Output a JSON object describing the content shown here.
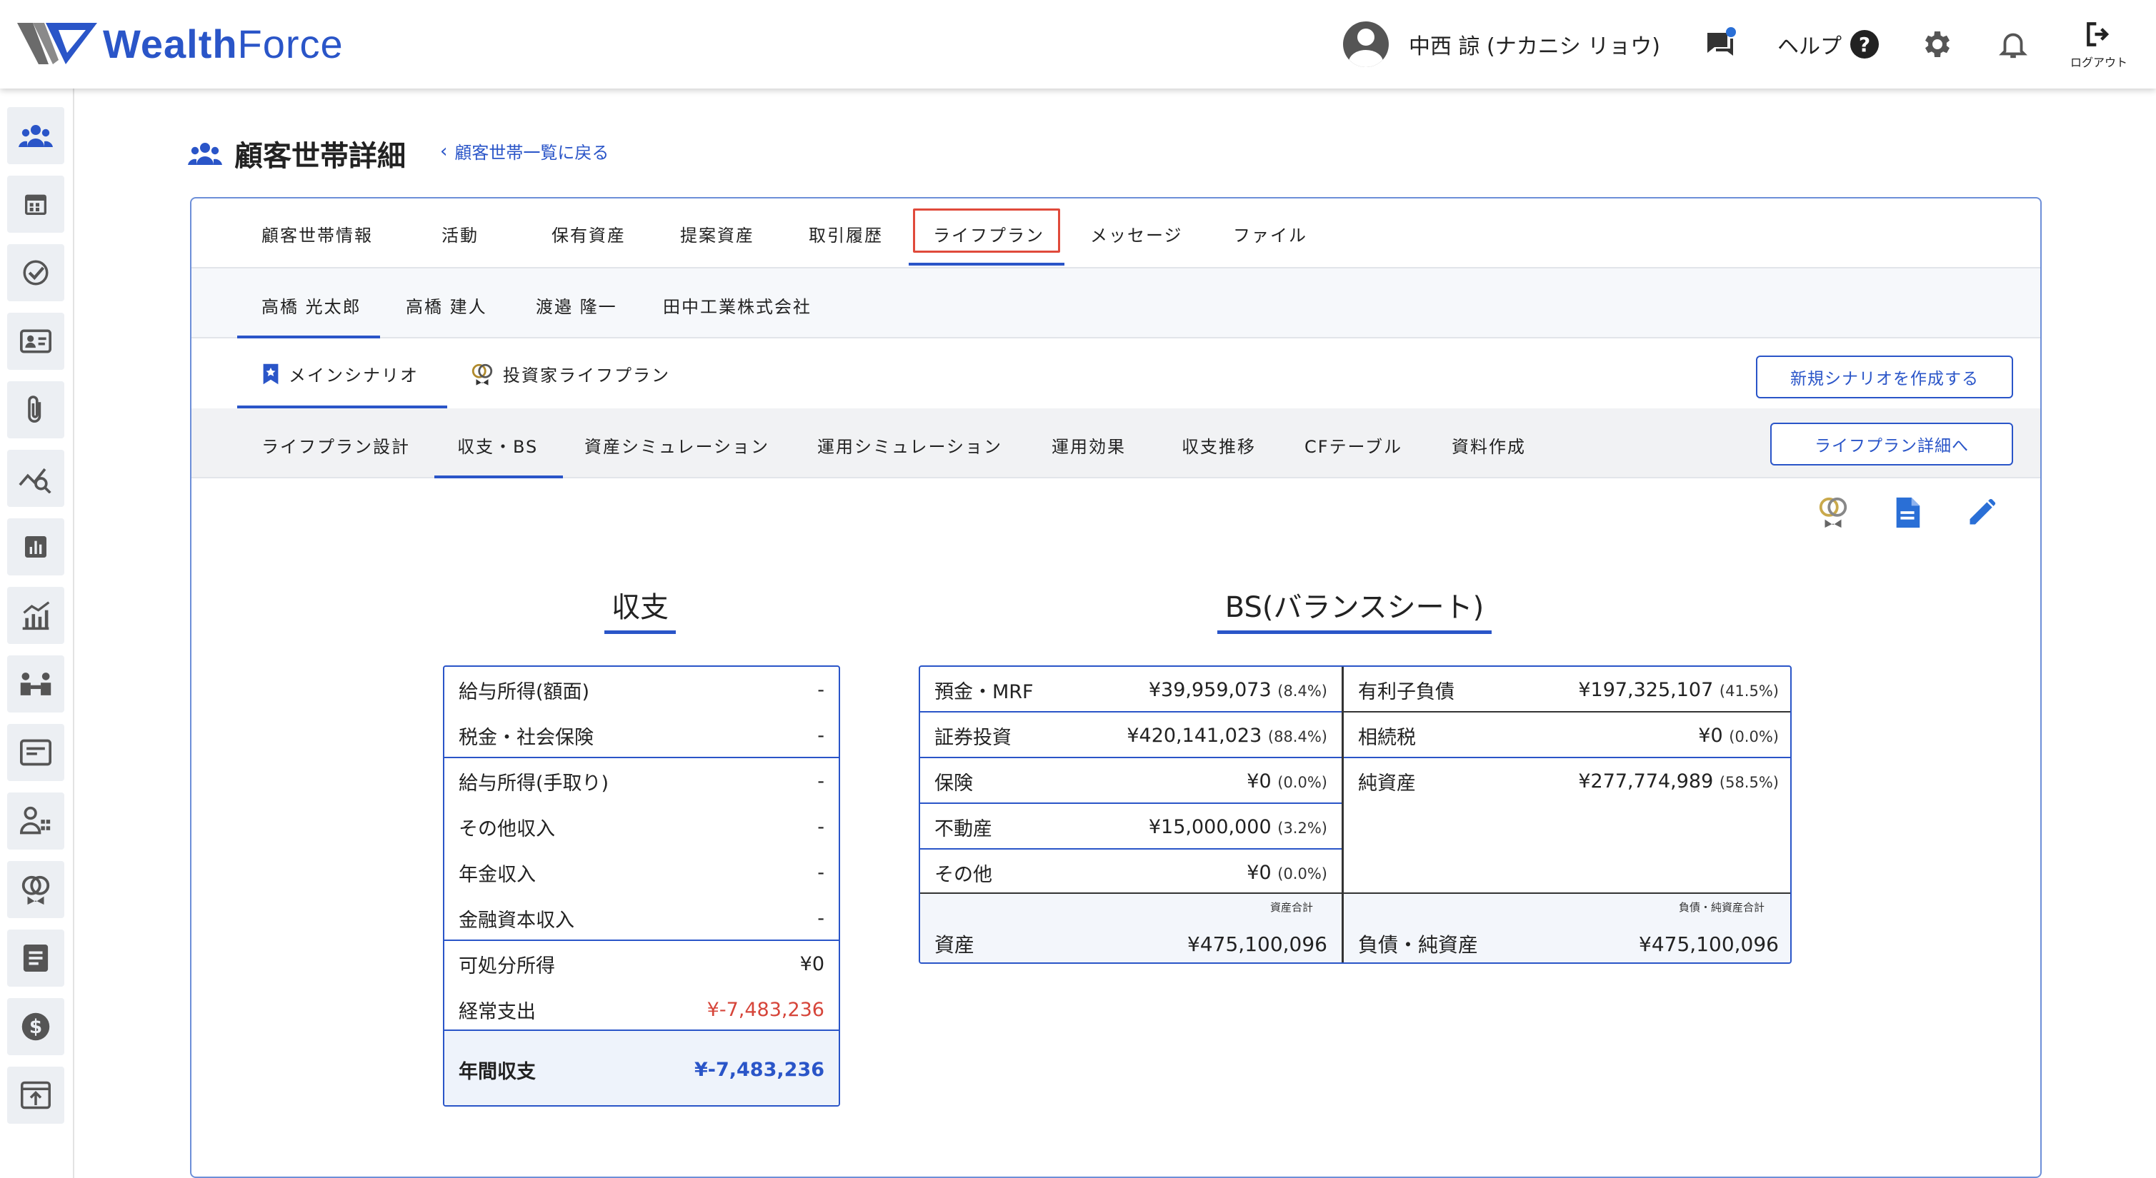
{
  "header": {
    "brand_a": "Wealth",
    "brand_b": "Force",
    "user_name": "中西 諒 (ナカニシ リョウ)",
    "help_label": "ヘルプ",
    "logout_label": "ログアウト"
  },
  "page": {
    "title": "顧客世帯詳細",
    "back_link": "顧客世帯一覧に戻る"
  },
  "tabs_main": [
    "顧客世帯情報",
    "活動",
    "保有資産",
    "提案資産",
    "取引履歴",
    "ライフプラン",
    "メッセージ",
    "ファイル"
  ],
  "tabs_members": [
    "高橋 光太郎",
    "高橋 建人",
    "渡邉 隆一",
    "田中工業株式会社"
  ],
  "tabs_scenario": [
    "メインシナリオ",
    "投資家ライフプラン"
  ],
  "new_scenario_button": "新規シナリオを作成する",
  "tabs_sub": [
    "ライフプラン設計",
    "収支・BS",
    "資産シミュレーション",
    "運用シミュレーション",
    "運用効果",
    "収支推移",
    "CFテーブル",
    "資料作成"
  ],
  "lifeplan_detail_button": "ライフプラン詳細へ",
  "income": {
    "title": "収支",
    "rows": [
      {
        "label": "給与所得(額面)",
        "value": "-"
      },
      {
        "label": "税金・社会保険",
        "value": "-"
      },
      {
        "label": "給与所得(手取り)",
        "value": "-"
      },
      {
        "label": "その他収入",
        "value": "-"
      },
      {
        "label": "年金収入",
        "value": "-"
      },
      {
        "label": "金融資本収入",
        "value": "-"
      },
      {
        "label": "可処分所得",
        "value": "¥0"
      },
      {
        "label": "経常支出",
        "value": "¥-7,483,236"
      }
    ],
    "total_label": "年間収支",
    "total_value": "¥-7,483,236"
  },
  "bs": {
    "title": "BS(バランスシート)",
    "assets": [
      {
        "label": "預金・MRF",
        "value": "¥39,959,073",
        "pct": "(8.4%)"
      },
      {
        "label": "証券投資",
        "value": "¥420,141,023",
        "pct": "(88.4%)"
      },
      {
        "label": "保険",
        "value": "¥0",
        "pct": "(0.0%)"
      },
      {
        "label": "不動産",
        "value": "¥15,000,000",
        "pct": "(3.2%)"
      },
      {
        "label": "その他",
        "value": "¥0",
        "pct": "(0.0%)"
      }
    ],
    "liabilities": [
      {
        "label": "有利子負債",
        "value": "¥197,325,107",
        "pct": "(41.5%)"
      },
      {
        "label": "相続税",
        "value": "¥0",
        "pct": "(0.0%)"
      },
      {
        "label": "純資産",
        "value": "¥277,774,989",
        "pct": "(58.5%)"
      }
    ],
    "asset_total_caption": "資産合計",
    "asset_total_label": "資産",
    "asset_total_value": "¥475,100,096",
    "liab_total_caption": "負債・純資産合計",
    "liab_total_label": "負債・純資産",
    "liab_total_value": "¥475,100,096"
  }
}
